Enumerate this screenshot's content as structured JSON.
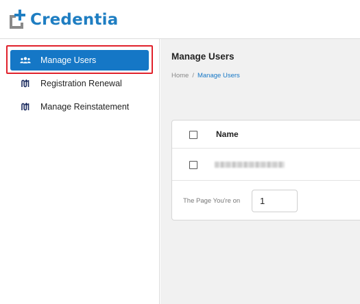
{
  "brand": {
    "name": "Credentia",
    "accent": "#1f7ec2",
    "logo_gray": "#8a8a8a"
  },
  "sidebar": {
    "items": [
      {
        "label": "Manage Users",
        "icon": "users-icon",
        "active": true
      },
      {
        "label": "Registration Renewal",
        "icon": "renewal-icon",
        "active": false
      },
      {
        "label": "Manage Reinstatement",
        "icon": "reinstatement-icon",
        "active": false
      }
    ],
    "active_color": "#1577c6",
    "highlight_color": "#e0202a"
  },
  "main": {
    "title": "Manage Users",
    "breadcrumb": {
      "home": "Home",
      "separator": "/",
      "current": "Manage Users"
    },
    "table": {
      "columns": [
        "Name"
      ],
      "rows": [
        {
          "name_redacted": true
        }
      ]
    },
    "pager": {
      "label": "The Page You're on",
      "page": "1"
    }
  }
}
